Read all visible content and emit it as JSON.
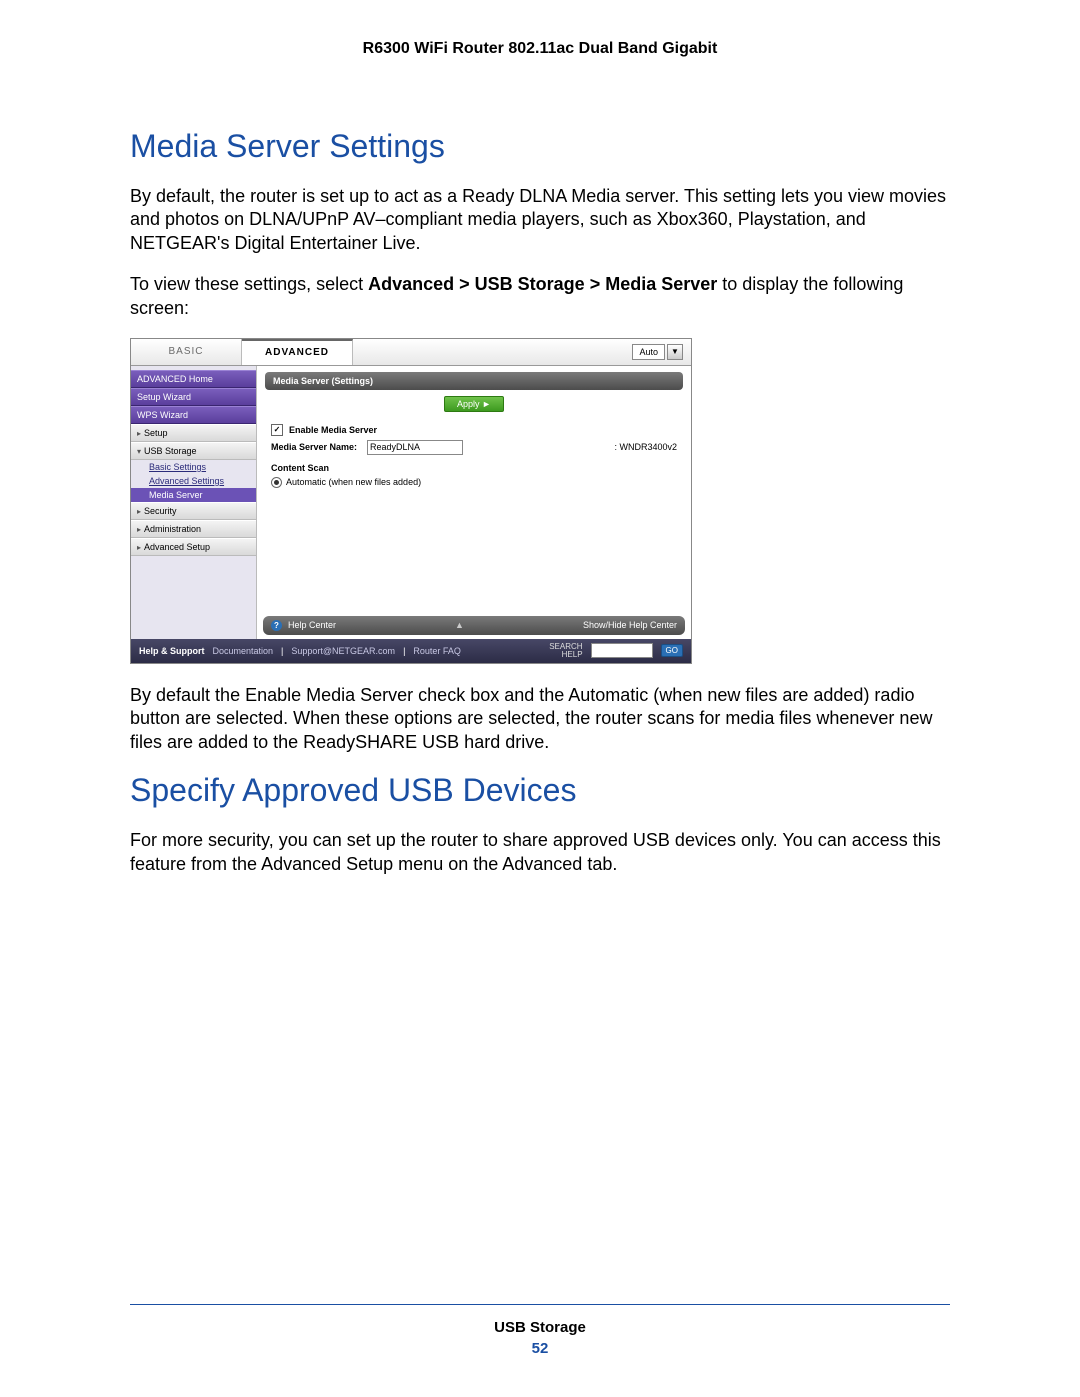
{
  "header": {
    "title": "R6300 WiFi Router 802.11ac Dual Band Gigabit"
  },
  "section1": {
    "heading": "Media Server Settings",
    "p1": "By default, the router is set up to act as a Ready DLNA Media server. This setting lets you view movies and photos on DLNA/UPnP AV–compliant media players, such as Xbox360, Playstation, and NETGEAR's Digital Entertainer Live.",
    "p2a": "To view these settings, select ",
    "p2bold": "Advanced > USB Storage > Media Server",
    "p2b": " to display the following screen:",
    "p3": "By default the Enable Media Server check box and the Automatic (when new files are added) radio button are selected. When these options are selected, the router scans for media files whenever new files are added to the ReadySHARE USB hard drive."
  },
  "section2": {
    "heading": "Specify Approved USB Devices",
    "p1": "For more security, you can set up the router to share approved USB devices only. You can access this feature from the Advanced Setup menu on the Advanced tab."
  },
  "router": {
    "tab_basic": "BASIC",
    "tab_advanced": "ADVANCED",
    "auto_label": "Auto",
    "side": {
      "adv_home": "ADVANCED Home",
      "setup_wizard": "Setup Wizard",
      "wps_wizard": "WPS Wizard",
      "setup": "Setup",
      "usb_storage": "USB Storage",
      "basic_settings": "Basic Settings",
      "advanced_settings": "Advanced Settings",
      "media_server": "Media Server",
      "security": "Security",
      "administration": "Administration",
      "advanced_setup": "Advanced Setup"
    },
    "main": {
      "title": "Media Server (Settings)",
      "apply": "Apply ►",
      "enable_label": "Enable Media Server",
      "name_label": "Media Server Name:",
      "name_value": "ReadyDLNA",
      "name_suffix": ": WNDR3400v2",
      "content_scan": "Content Scan",
      "auto_scan": "Automatic (when new files added)"
    },
    "help": {
      "label": "Help Center",
      "toggle": "Show/Hide Help Center"
    },
    "footer": {
      "help_support": "Help & Support",
      "documentation": "Documentation",
      "support_link": "Support@NETGEAR.com",
      "faq": "Router FAQ",
      "search_label1": "SEARCH",
      "search_label2": "HELP",
      "go": "GO"
    }
  },
  "page_footer": {
    "chapter": "USB Storage",
    "page": "52"
  }
}
